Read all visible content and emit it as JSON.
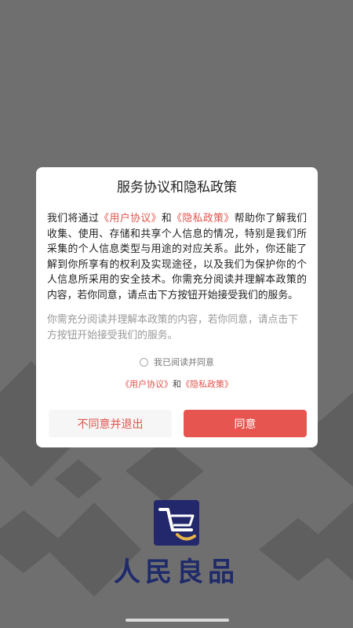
{
  "dialog": {
    "title": "服务协议和隐私政策",
    "body": {
      "p1": "我们将通过",
      "link_user": "《用户协议》",
      "p2": "和",
      "link_privacy": "《隐私政策》",
      "p3": "帮助你了解我们收集、使用、存储和共享个人信息的情况，特别是我们所采集的个人信息类型与用途的对应关系。此外，你还能了解到你所享有的权利及实现途径，以及我们为保护你的个人信息所采用的安全技术。你需充分阅读并理解本政策的内容，若你同意，请点击下方按钮开始接受我们的服务。"
    },
    "note": "你需充分阅读并理解本政策的内容，若你同意，请点击下方按钮开始接受我们的服务。",
    "consent_label": "我已阅读并同意",
    "links": {
      "user": "《用户协议》",
      "and": "和",
      "privacy": "《隐私政策》"
    },
    "buttons": {
      "disagree": "不同意并退出",
      "agree": "同意"
    }
  },
  "brand": {
    "name": "人民良品",
    "logo_icon": "cart-logo-icon"
  },
  "colors": {
    "accent": "#e6554f",
    "brand": "#1f2a6b",
    "overlay": "#6f6f6f"
  }
}
